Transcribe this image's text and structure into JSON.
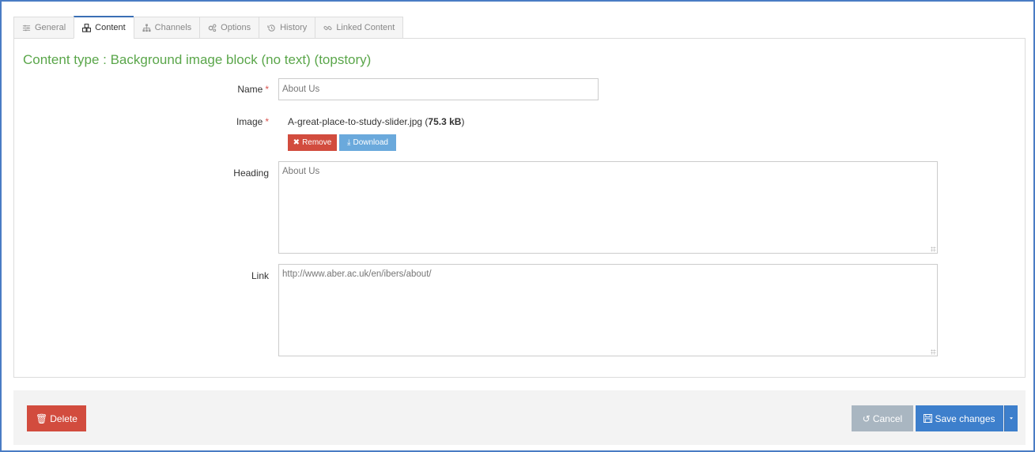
{
  "tabs": [
    {
      "label": "General",
      "icon": "sliders-icon"
    },
    {
      "label": "Content",
      "icon": "cubes-icon"
    },
    {
      "label": "Channels",
      "icon": "sitemap-icon"
    },
    {
      "label": "Options",
      "icon": "gears-icon"
    },
    {
      "label": "History",
      "icon": "history-icon"
    },
    {
      "label": "Linked Content",
      "icon": "link-icon"
    }
  ],
  "active_tab": "Content",
  "content_title": "Content type : Background image block (no text) (topstory)",
  "form": {
    "name_label": "Name",
    "name_value": "About Us",
    "image_label": "Image",
    "image_filename": "A-great-place-to-study-slider.jpg",
    "image_size": "75.3 kB",
    "remove_label": "Remove",
    "download_label": "Download",
    "heading_label": "Heading",
    "heading_value": "About Us",
    "link_label": "Link",
    "link_value": "http://www.aber.ac.uk/en/ibers/about/",
    "required_marker": "*"
  },
  "footer": {
    "delete_label": "Delete",
    "cancel_label": "Cancel",
    "save_label": "Save changes"
  },
  "colors": {
    "accent": "#3d7fcc",
    "title_green": "#5aa64a",
    "danger": "#d24c3e",
    "info": "#6aa9dc",
    "muted": "#a9b6c1"
  }
}
